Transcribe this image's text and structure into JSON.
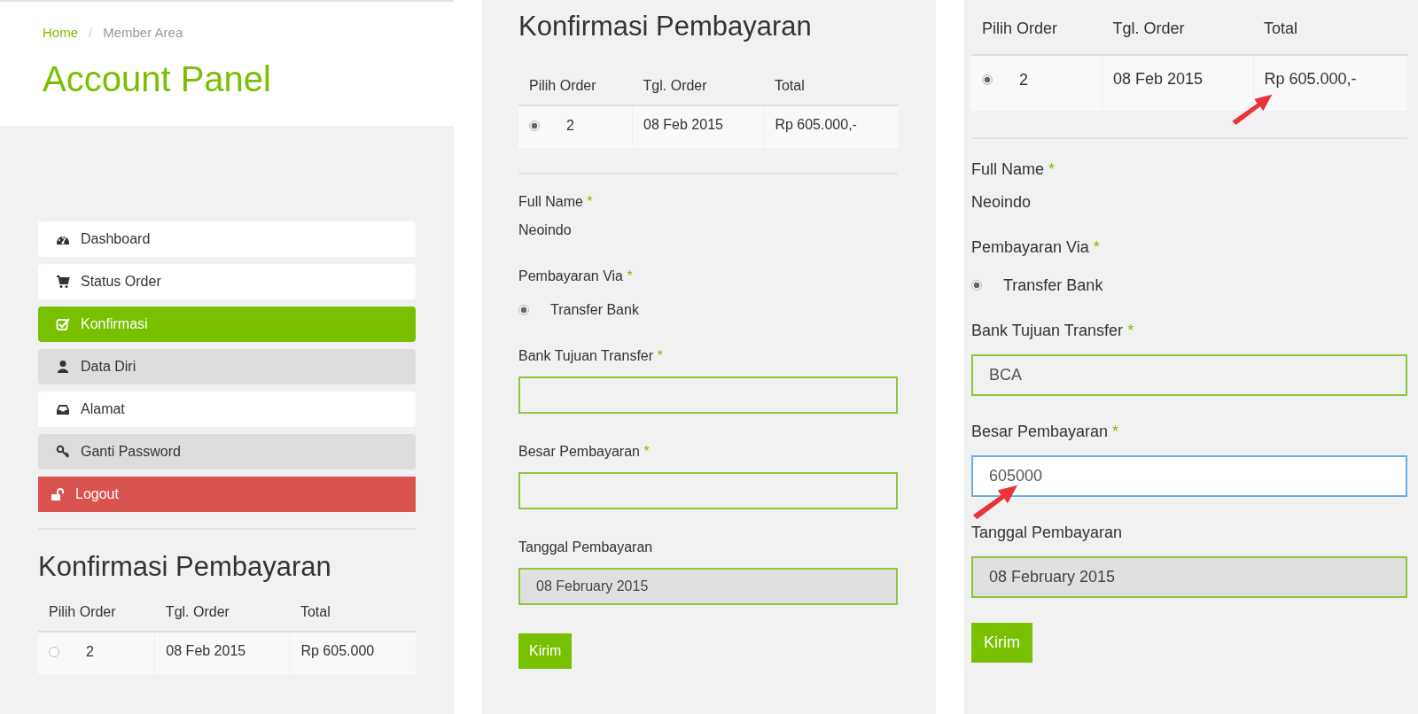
{
  "panels": [
    {
      "kind": "account",
      "blocks": [
        {
          "kind": "header",
          "breadcrumb": [
            {
              "label": "Home",
              "link": true
            },
            {
              "label": "Member Area",
              "link": false
            }
          ],
          "separator": "/",
          "title": "Account Panel"
        },
        {
          "kind": "menu",
          "items": [
            {
              "label": "Dashboard",
              "kind": "plain",
              "selected": false
            },
            {
              "label": "Status Order",
              "kind": "plain",
              "selected": false
            },
            {
              "label": "Konfirmasi",
              "kind": "plain",
              "selected": true
            },
            {
              "label": "Data Diri",
              "kind": "shaded",
              "selected": false
            },
            {
              "label": "Alamat",
              "kind": "plain",
              "selected": false
            },
            {
              "label": "Ganti Password",
              "kind": "shaded",
              "selected": false
            },
            {
              "label": "Logout",
              "kind": "danger",
              "selected": false
            }
          ]
        },
        {
          "kind": "heading",
          "text": "Konfirmasi Pembayaran"
        },
        {
          "kind": "order_table",
          "columns": [
            "Pilih Order",
            "Tgl. Order",
            "Total"
          ],
          "rows": [
            {
              "selected": false,
              "cells": [
                "2",
                "08 Feb 2015",
                "Rp 605.000"
              ],
              "arrow": false
            }
          ]
        }
      ]
    },
    {
      "kind": "form",
      "blocks": [
        {
          "kind": "heading",
          "text": "Konfirmasi Pembayaran"
        },
        {
          "kind": "order_table",
          "columns": [
            "Pilih Order",
            "Tgl. Order",
            "Total"
          ],
          "rows": [
            {
              "selected": true,
              "cells": [
                "2",
                "08 Feb 2015",
                "Rp 605.000,-"
              ],
              "arrow": false
            }
          ]
        },
        {
          "kind": "form",
          "fields": [
            {
              "kind": "static",
              "label": "Full Name",
              "required_mark": "*",
              "value": "Neoindo"
            },
            {
              "kind": "radio",
              "label": "Pembayaran Via",
              "required_mark": "*",
              "options": [
                {
                  "label": "Transfer Bank",
                  "selected": true
                }
              ]
            },
            {
              "kind": "input",
              "label": "Bank Tujuan Transfer",
              "required_mark": "*",
              "focused": false,
              "readonly": false,
              "arrow": false
            },
            {
              "kind": "input",
              "label": "Besar Pembayaran",
              "required_mark": "*",
              "focused": false,
              "readonly": false,
              "arrow": false
            },
            {
              "kind": "input",
              "label": "Tanggal Pembayaran",
              "value": "08 February 2015",
              "focused": false,
              "readonly": true,
              "arrow": false
            }
          ],
          "button": "Kirim"
        }
      ]
    },
    {
      "kind": "form_zoomed",
      "blocks": [
        {
          "kind": "order_table",
          "columns": [
            "Pilih Order",
            "Tgl. Order",
            "Total"
          ],
          "rows": [
            {
              "selected": true,
              "cells": [
                "2",
                "08 Feb 2015",
                "Rp 605.000,-"
              ],
              "arrow": true
            }
          ]
        },
        {
          "kind": "form",
          "fields": [
            {
              "kind": "static",
              "label": "Full Name",
              "required_mark": "*",
              "value": "Neoindo"
            },
            {
              "kind": "radio",
              "label": "Pembayaran Via",
              "required_mark": "*",
              "options": [
                {
                  "label": "Transfer Bank",
                  "selected": true
                }
              ]
            },
            {
              "kind": "input",
              "label": "Bank Tujuan Transfer",
              "required_mark": "*",
              "value": "BCA",
              "focused": false,
              "readonly": false,
              "arrow": false
            },
            {
              "kind": "input",
              "label": "Besar Pembayaran",
              "required_mark": "*",
              "value": "605000",
              "focused": true,
              "readonly": false,
              "arrow": true
            },
            {
              "kind": "input",
              "label": "Tanggal Pembayaran",
              "value": "08 February 2015",
              "focused": false,
              "readonly": true,
              "arrow": false
            }
          ],
          "button": "Kirim"
        }
      ]
    }
  ]
}
